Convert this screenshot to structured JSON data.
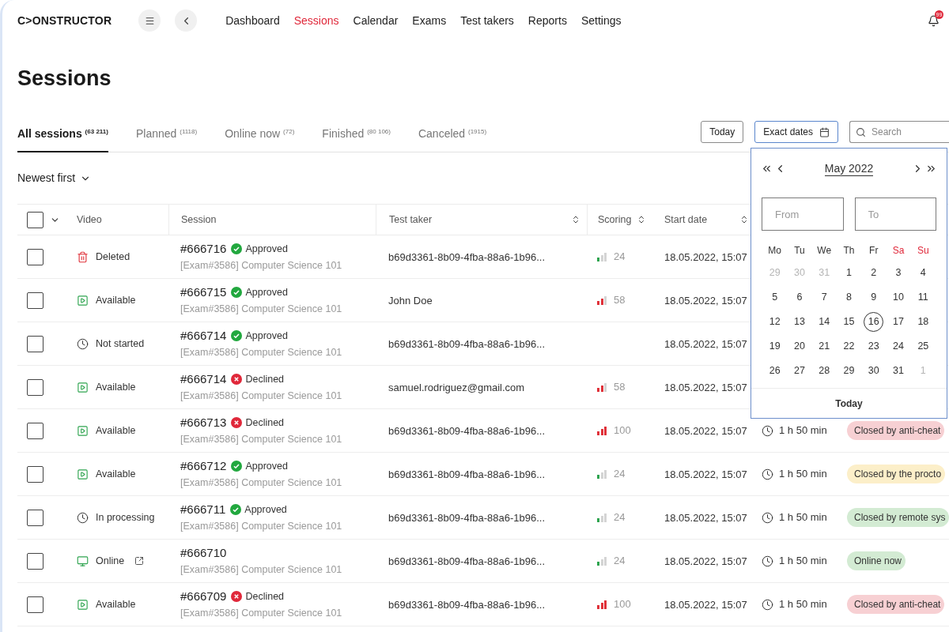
{
  "header": {
    "logo": "C>ONSTRUCTOR",
    "nav": [
      {
        "label": "Dashboard",
        "selected": false
      },
      {
        "label": "Sessions",
        "selected": true
      },
      {
        "label": "Calendar",
        "selected": false
      },
      {
        "label": "Exams",
        "selected": false
      },
      {
        "label": "Test takers",
        "selected": false
      },
      {
        "label": "Reports",
        "selected": false
      },
      {
        "label": "Settings",
        "selected": false
      }
    ],
    "notification_badge": "99"
  },
  "page_title": "Sessions",
  "tabs": [
    {
      "label": "All sessions",
      "count": "(63 211)",
      "selected": true
    },
    {
      "label": "Planned",
      "count": "(1118)",
      "selected": false
    },
    {
      "label": "Online now",
      "count": "(72)",
      "selected": false
    },
    {
      "label": "Finished",
      "count": "(80 106)",
      "selected": false
    },
    {
      "label": "Canceled",
      "count": "(1915)",
      "selected": false
    }
  ],
  "toolbar": {
    "today_button": "Today",
    "exact_dates_button": {
      "label": "Exact dates",
      "active": true
    },
    "search": {
      "placeholder": "Search"
    }
  },
  "sort": "Newest first",
  "table": {
    "select_all_checked": false,
    "columns": [
      {
        "label": "Video",
        "sortable": false
      },
      {
        "label": "Session",
        "sortable": false
      },
      {
        "label": "Test taker",
        "sortable": true
      },
      {
        "label": "Scoring",
        "sortable": true
      },
      {
        "label": "Start date",
        "sortable": true
      }
    ],
    "rows": [
      {
        "checked": false,
        "video": {
          "kind": "deleted",
          "label": "Deleted"
        },
        "session_id": "#666716",
        "decision": {
          "kind": "approved",
          "label": "Approved"
        },
        "exam": "[Exam#3586] Computer Science 101",
        "test_taker": "b69d3361-8b09-4fba-88a6-1b96...",
        "score": {
          "value": "24",
          "kind": "low",
          "color": "#2ea44f"
        },
        "start_date": "18.05.2022, 15:07"
      },
      {
        "checked": false,
        "video": {
          "kind": "available",
          "label": "Available"
        },
        "session_id": "#666715",
        "decision": {
          "kind": "approved",
          "label": "Approved"
        },
        "exam": "[Exam#3586] Computer Science 101",
        "test_taker": "John Doe",
        "score": {
          "value": "58",
          "kind": "medium",
          "color": "#e0323a"
        },
        "start_date": "18.05.2022, 15:07"
      },
      {
        "checked": false,
        "video": {
          "kind": "pending",
          "label": "Not started"
        },
        "session_id": "#666714",
        "decision": {
          "kind": "approved",
          "label": "Approved"
        },
        "exam": "[Exam#3586] Computer Science 101",
        "test_taker": "b69d3361-8b09-4fba-88a6-1b96...",
        "start_date": "18.05.2022, 15:07"
      },
      {
        "checked": false,
        "video": {
          "kind": "available",
          "label": "Available"
        },
        "session_id": "#666714",
        "decision": {
          "kind": "declined",
          "label": "Declined"
        },
        "exam": "[Exam#3586] Computer Science 101",
        "test_taker": "samuel.rodriguez@gmail.com",
        "score": {
          "value": "58",
          "kind": "medium",
          "color": "#e0323a"
        },
        "start_date": "18.05.2022, 15:07"
      },
      {
        "checked": false,
        "video": {
          "kind": "available",
          "label": "Available"
        },
        "session_id": "#666713",
        "decision": {
          "kind": "declined",
          "label": "Declined"
        },
        "exam": "[Exam#3586] Computer Science 101",
        "test_taker": "b69d3361-8b09-4fba-88a6-1b96...",
        "score": {
          "value": "100",
          "kind": "high",
          "color": "#e0323a"
        },
        "start_date": "18.05.2022, 15:07",
        "duration": "1 h 50 min",
        "status": {
          "label": "Closed by anti-cheat",
          "color": "#f7d0d3"
        }
      },
      {
        "checked": false,
        "video": {
          "kind": "available",
          "label": "Available"
        },
        "session_id": "#666712",
        "decision": {
          "kind": "approved",
          "label": "Approved"
        },
        "exam": "[Exam#3586] Computer Science 101",
        "test_taker": "b69d3361-8b09-4fba-88a6-1b96...",
        "score": {
          "value": "24",
          "kind": "low",
          "color": "#2ea44f"
        },
        "start_date": "18.05.2022, 15:07",
        "duration": "1 h 50 min",
        "status": {
          "label": "Closed by the procto",
          "color": "#fcefc9"
        }
      },
      {
        "checked": false,
        "video": {
          "kind": "pending",
          "label": "In processing"
        },
        "session_id": "#666711",
        "decision": {
          "kind": "approved",
          "label": "Approved"
        },
        "exam": "[Exam#3586] Computer Science 101",
        "test_taker": "b69d3361-8b09-4fba-88a6-1b96...",
        "score": {
          "value": "24",
          "kind": "low",
          "color": "#2ea44f"
        },
        "start_date": "18.05.2022, 15:07",
        "duration": "1 h 50 min",
        "status": {
          "label": "Closed by remote sys",
          "color": "#d3ebd3"
        }
      },
      {
        "checked": false,
        "video": {
          "kind": "online",
          "label": "Online"
        },
        "session_id": "#666710",
        "exam": "[Exam#3586] Computer Science 101",
        "test_taker": "b69d3361-8b09-4fba-88a6-1b96...",
        "score": {
          "value": "24",
          "kind": "low",
          "color": "#2ea44f"
        },
        "start_date": "18.05.2022, 15:07",
        "duration": "1 h 50 min",
        "status": {
          "label": "Online now",
          "color": "#d3ebd3"
        }
      },
      {
        "checked": false,
        "video": {
          "kind": "available",
          "label": "Available"
        },
        "session_id": "#666709",
        "decision": {
          "kind": "declined",
          "label": "Declined"
        },
        "exam": "[Exam#3586] Computer Science 101",
        "test_taker": "b69d3361-8b09-4fba-88a6-1b96...",
        "score": {
          "value": "100",
          "kind": "high",
          "color": "#e0323a"
        },
        "start_date": "18.05.2022, 15:07",
        "duration": "1 h 50 min",
        "status": {
          "label": "Closed by anti-cheat",
          "color": "#f7d0d3"
        }
      }
    ]
  },
  "date_picker": {
    "month": "May 2022",
    "from_placeholder": "From",
    "to_placeholder": "To",
    "weekdays": [
      {
        "label": "Mo",
        "weekend": false
      },
      {
        "label": "Tu",
        "weekend": false
      },
      {
        "label": "We",
        "weekend": false
      },
      {
        "label": "Th",
        "weekend": false
      },
      {
        "label": "Fr",
        "weekend": false
      },
      {
        "label": "Sa",
        "weekend": true
      },
      {
        "label": "Su",
        "weekend": true
      }
    ],
    "weeks": [
      [
        {
          "day": "29",
          "outside": true,
          "selected": false
        },
        {
          "day": "30",
          "outside": true,
          "selected": false
        },
        {
          "day": "31",
          "outside": true,
          "selected": false
        },
        {
          "day": "1",
          "outside": false,
          "selected": false
        },
        {
          "day": "2",
          "outside": false,
          "selected": false
        },
        {
          "day": "3",
          "outside": false,
          "selected": false
        },
        {
          "day": "4",
          "outside": false,
          "selected": false
        }
      ],
      [
        {
          "day": "5",
          "outside": false,
          "selected": false
        },
        {
          "day": "6",
          "outside": false,
          "selected": false
        },
        {
          "day": "7",
          "outside": false,
          "selected": false
        },
        {
          "day": "8",
          "outside": false,
          "selected": false
        },
        {
          "day": "9",
          "outside": false,
          "selected": false
        },
        {
          "day": "10",
          "outside": false,
          "selected": false
        },
        {
          "day": "11",
          "outside": false,
          "selected": false
        }
      ],
      [
        {
          "day": "12",
          "outside": false,
          "selected": false
        },
        {
          "day": "13",
          "outside": false,
          "selected": false
        },
        {
          "day": "14",
          "outside": false,
          "selected": false
        },
        {
          "day": "15",
          "outside": false,
          "selected": false
        },
        {
          "day": "16",
          "outside": false,
          "selected": true
        },
        {
          "day": "17",
          "outside": false,
          "selected": false
        },
        {
          "day": "18",
          "outside": false,
          "selected": false
        }
      ],
      [
        {
          "day": "19",
          "outside": false,
          "selected": false
        },
        {
          "day": "20",
          "outside": false,
          "selected": false
        },
        {
          "day": "21",
          "outside": false,
          "selected": false
        },
        {
          "day": "22",
          "outside": false,
          "selected": false
        },
        {
          "day": "23",
          "outside": false,
          "selected": false
        },
        {
          "day": "24",
          "outside": false,
          "selected": false
        },
        {
          "day": "25",
          "outside": false,
          "selected": false
        }
      ],
      [
        {
          "day": "26",
          "outside": false,
          "selected": false
        },
        {
          "day": "27",
          "outside": false,
          "selected": false
        },
        {
          "day": "28",
          "outside": false,
          "selected": false
        },
        {
          "day": "29",
          "outside": false,
          "selected": false
        },
        {
          "day": "30",
          "outside": false,
          "selected": false
        },
        {
          "day": "31",
          "outside": false,
          "selected": false
        },
        {
          "day": "1",
          "outside": true,
          "selected": false
        }
      ]
    ],
    "today_button": "Today"
  }
}
